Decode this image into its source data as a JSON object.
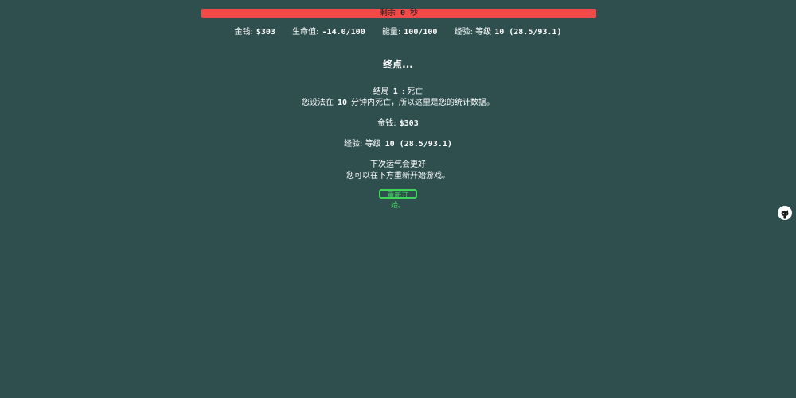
{
  "timer": {
    "prefix": "剩余",
    "value": "0",
    "suffix": "秒"
  },
  "stats": {
    "money_label": "金钱:",
    "money_value": "$303",
    "health_label": "生命值:",
    "health_value": "-14.0/100",
    "energy_label": "能量:",
    "energy_value": "100/100",
    "exp_label": "经验: 等级",
    "exp_value": "10 (28.5/93.1)"
  },
  "end": {
    "title": "终点...",
    "ending_label": "结局",
    "ending_number": "1",
    "ending_name": ": 死亡",
    "death_pre": "您设法在",
    "death_minutes": "10",
    "death_post": "分钟内死亡，所以这里是您的统计数据。",
    "money_label": "金钱:",
    "money_value": "$303",
    "exp_label": "经验: 等级",
    "exp_value": "10 (28.5/93.1)",
    "luck_line": "下次运气会更好",
    "restart_hint": "您可以在下方重新开始游戏。",
    "restart_button": "重新开始。"
  },
  "icons": {
    "corner": "github-icon"
  },
  "colors": {
    "background": "#2f4f4f",
    "timer_bar": "#f24a48",
    "restart_button": "#42d35b"
  }
}
